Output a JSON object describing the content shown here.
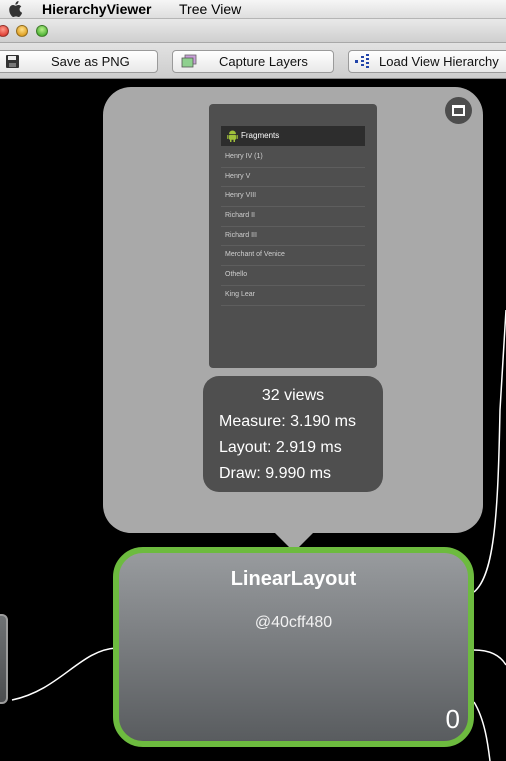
{
  "menubar": {
    "app_name": "HierarchyViewer",
    "menu_item": "Tree View"
  },
  "toolbar": {
    "save_png_label": "Save as PNG",
    "capture_layers_label": "Capture Layers",
    "load_view_hierarchy_label": "Load View Hierarchy"
  },
  "popup": {
    "preview": {
      "action_bar_title": "Fragments",
      "list_items": [
        "Henry IV (1)",
        "Henry V",
        "Henry VIII",
        "Richard II",
        "Richard III",
        "Merchant of Venice",
        "Othello",
        "King Lear"
      ]
    },
    "stats": {
      "views": "32 views",
      "measure": "Measure: 3.190 ms",
      "layout": "Layout: 2.919 ms",
      "draw": "Draw: 9.990 ms"
    }
  },
  "node": {
    "class_name": "LinearLayout",
    "id": "@40cff480",
    "index": "0"
  },
  "colors": {
    "selected_border": "#6dbb3f",
    "popup_bg": "#a9a9a9",
    "canvas_bg": "#000000"
  }
}
